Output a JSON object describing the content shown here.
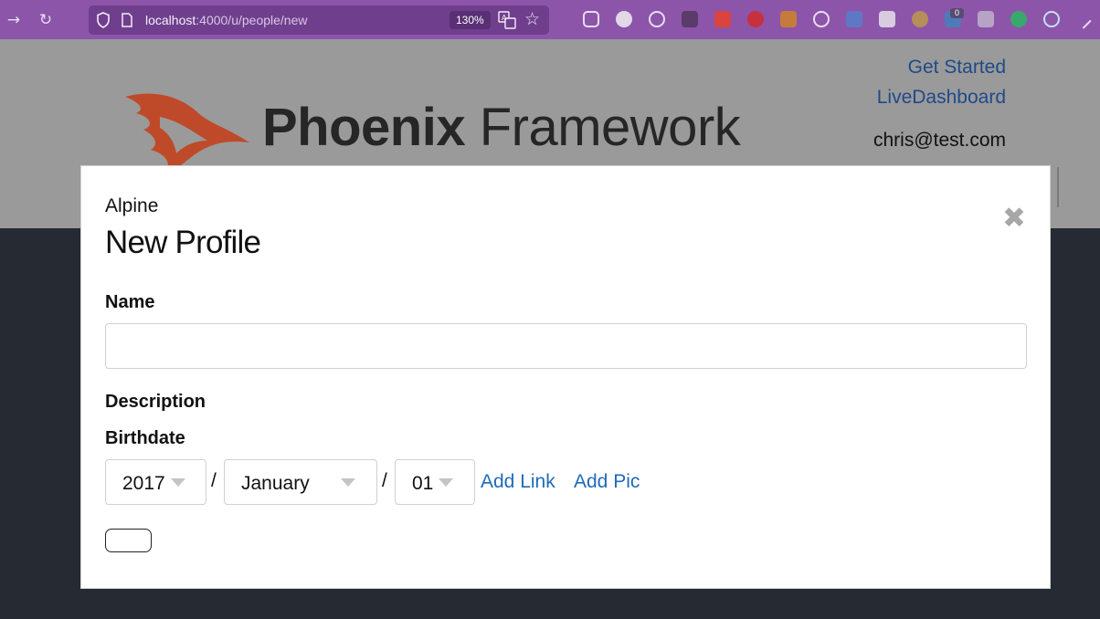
{
  "browser": {
    "url_host": "localhost",
    "url_path": ":4000/u/people/new",
    "zoom": "130%",
    "extension_badge": "0",
    "icons": {
      "back": "arrow-right-icon",
      "reload": "reload-icon",
      "shield": "shield-icon",
      "page": "page-icon",
      "translate": "translate-icon",
      "bookmark": "star-icon"
    }
  },
  "header": {
    "logo_word_bold": "Phoenix",
    "logo_word_regular": " Framework",
    "nav": {
      "get_started": "Get Started",
      "live_dashboard": "LiveDashboard",
      "user_email": "chris@test.com"
    }
  },
  "modal": {
    "subtitle": "Alpine",
    "title": "New Profile",
    "close_icon": "close-x-icon",
    "fields": {
      "name_label": "Name",
      "name_value": "",
      "description_label": "Description",
      "birthdate_label": "Birthdate",
      "year": "2017",
      "month": "January",
      "day": "01",
      "separator": "/"
    },
    "links": {
      "add_link": "Add Link",
      "add_pic": "Add Pic"
    }
  },
  "colors": {
    "toolbar": "#8c55aa",
    "link": "#1f6ab8",
    "backdrop": "#252a33"
  }
}
